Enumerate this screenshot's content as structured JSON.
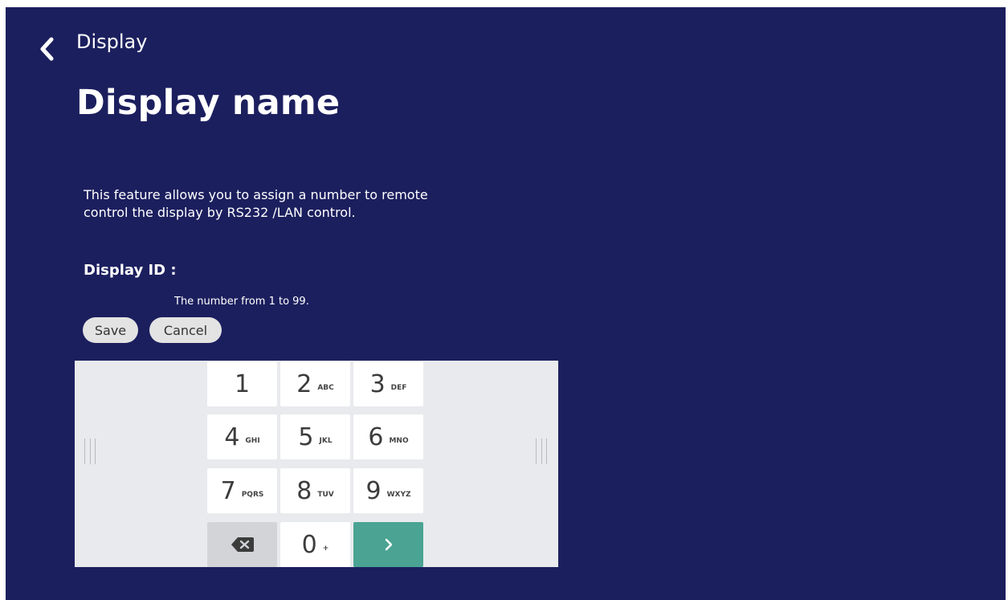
{
  "header": {
    "breadcrumb": "Display",
    "title": "Display name",
    "back_icon": "chevron-left-icon"
  },
  "content": {
    "description": "This feature allows you to assign a number to remote control the display by RS232 /LAN control.",
    "field_label": "Display ID :",
    "hint": "The number from 1 to 99.",
    "save_label": "Save",
    "cancel_label": "Cancel"
  },
  "keyboard": {
    "keys": [
      {
        "num": "1",
        "sub": ""
      },
      {
        "num": "2",
        "sub": "ABC"
      },
      {
        "num": "3",
        "sub": "DEF"
      },
      {
        "num": "4",
        "sub": "GHI"
      },
      {
        "num": "5",
        "sub": "JKL"
      },
      {
        "num": "6",
        "sub": "MNO"
      },
      {
        "num": "7",
        "sub": "PQRS"
      },
      {
        "num": "8",
        "sub": "TUV"
      },
      {
        "num": "9",
        "sub": "WXYZ"
      },
      {
        "num": "0",
        "sub": "+"
      }
    ],
    "backspace_icon": "backspace-icon",
    "next_icon": "chevron-right-icon"
  },
  "colors": {
    "background": "#1c1f5e",
    "keyboard_bg": "#e8eaed",
    "accent": "#4aa393",
    "button_bg": "#e3e3e3"
  }
}
